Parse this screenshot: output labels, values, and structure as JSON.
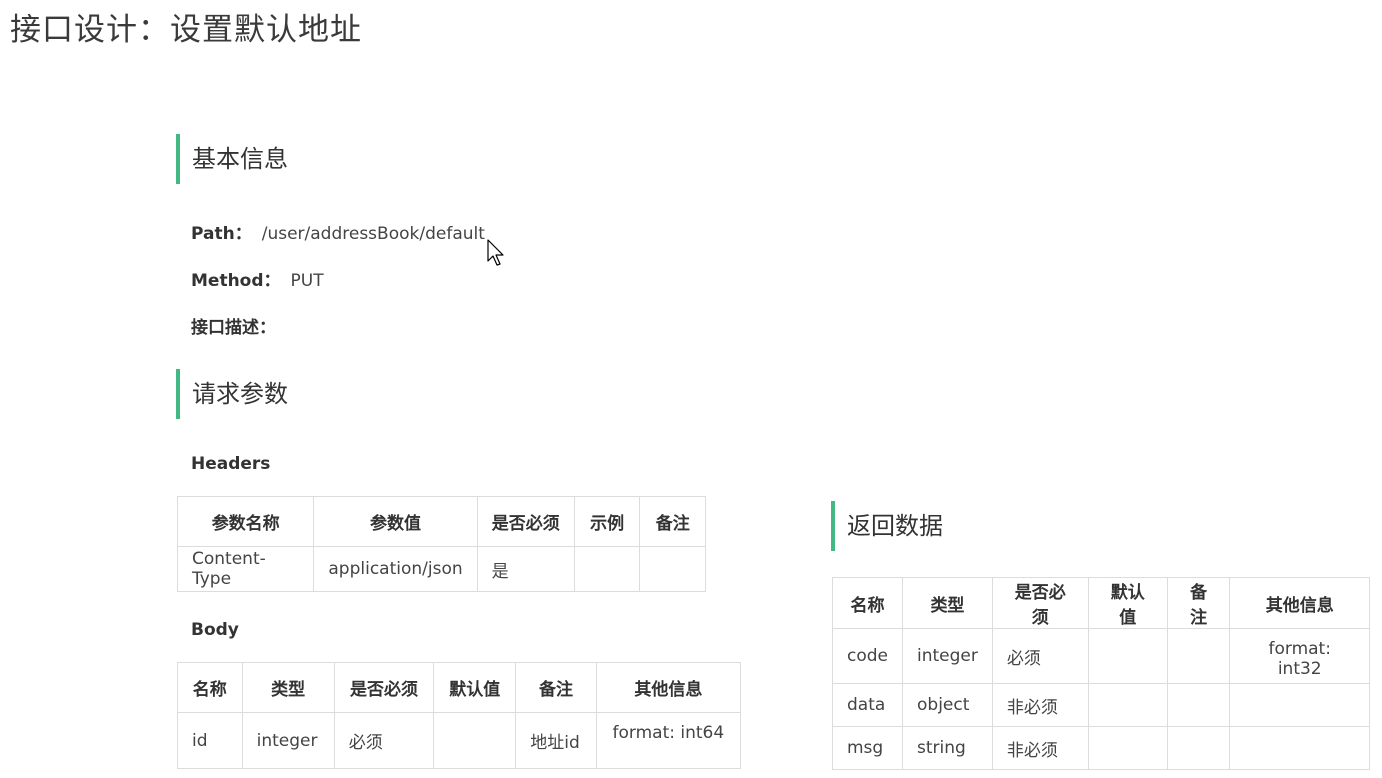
{
  "title": "接口设计：设置默认地址",
  "basic_info": {
    "heading": "基本信息",
    "path_label": "Path：",
    "path_value": "/user/addressBook/default",
    "method_label": "Method：",
    "method_value": "PUT",
    "desc_label": "接口描述："
  },
  "request": {
    "heading": "请求参数",
    "headers_label": "Headers",
    "headers_table": {
      "columns": [
        "参数名称",
        "参数值",
        "是否必须",
        "示例",
        "备注"
      ],
      "rows": [
        [
          "Content-Type",
          "application/json",
          "是",
          "",
          ""
        ]
      ]
    },
    "body_label": "Body",
    "body_table": {
      "columns": [
        "名称",
        "类型",
        "是否必须",
        "默认值",
        "备注",
        "其他信息"
      ],
      "rows": [
        [
          "id",
          "integer",
          "必须",
          "",
          "地址id",
          "format: int64"
        ]
      ]
    }
  },
  "response": {
    "heading": "返回数据",
    "table": {
      "columns": [
        "名称",
        "类型",
        "是否必须",
        "默认值",
        "备注",
        "其他信息"
      ],
      "rows": [
        [
          "code",
          "integer",
          "必须",
          "",
          "",
          "format: int32"
        ],
        [
          "data",
          "object",
          "非必须",
          "",
          "",
          ""
        ],
        [
          "msg",
          "string",
          "非必须",
          "",
          "",
          ""
        ]
      ]
    }
  },
  "icons": {
    "cursor": "mouse-pointer-icon"
  },
  "colors": {
    "accent": "#42b983",
    "border": "#dcdcdc"
  }
}
